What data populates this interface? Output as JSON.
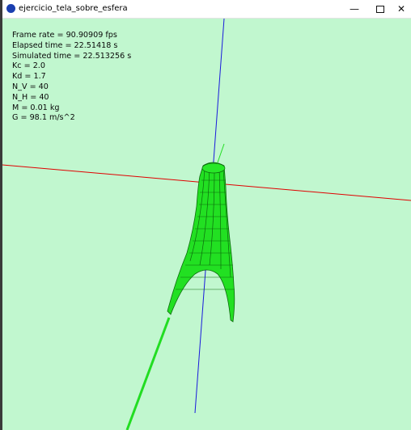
{
  "window": {
    "title": "ejercicio_tela_sobre_esfera",
    "minimize_glyph": "—",
    "close_glyph": "✕",
    "icon": "processing-app-icon"
  },
  "hud": {
    "lines": [
      "Frame rate = 90.90909 fps",
      "Elapsed time = 22.51418 s",
      "Simulated time = 22.513256 s",
      "Kc = 2.0",
      "Kd = 1.7",
      "N_V = 40",
      "N_H = 40",
      "M = 0.01 kg",
      "G = 98.1 m/s^2"
    ]
  },
  "colors": {
    "background": "#c1f7cf",
    "x_axis": "#e00000",
    "y_axis": "#1a1adc",
    "z_axis": "#22dd22",
    "cloth": "#22e022",
    "cloth_wire": "#0c6a0c"
  }
}
